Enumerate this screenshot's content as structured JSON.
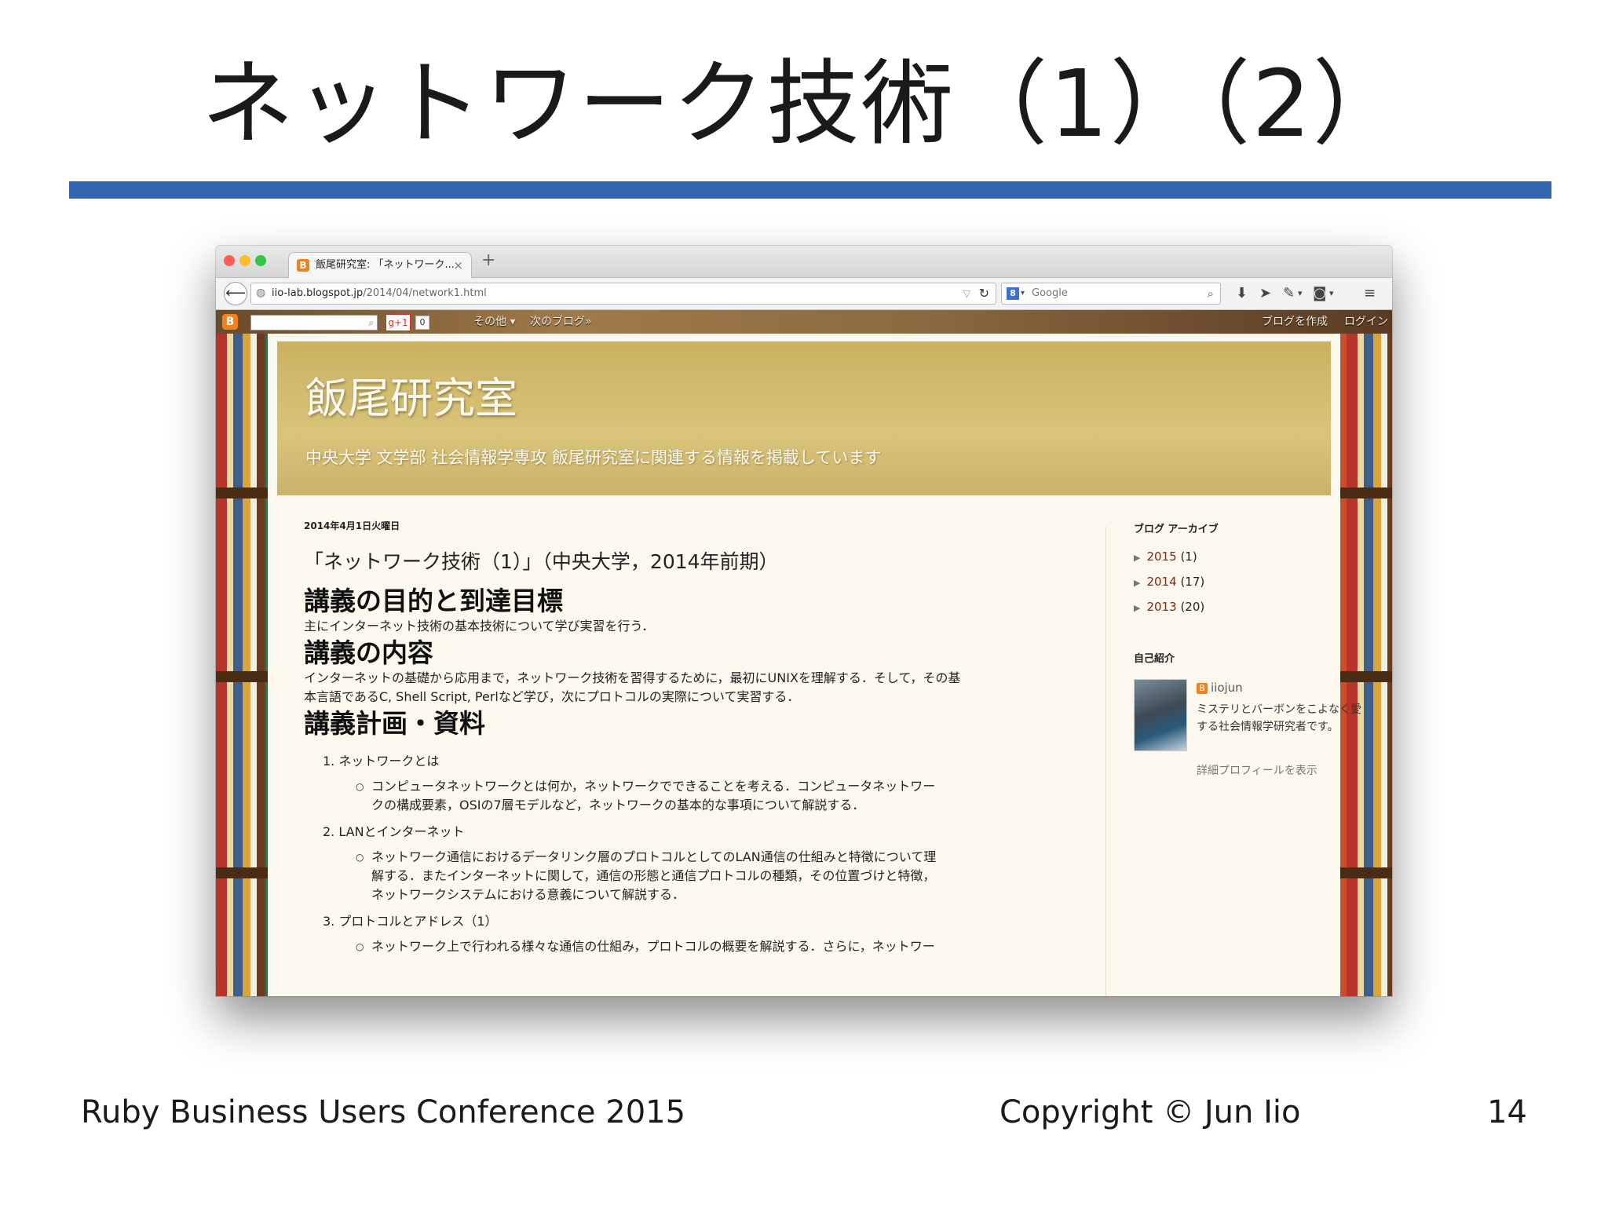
{
  "slide": {
    "title": "ネットワーク技術（1）（2）",
    "footer_left": "Ruby Business Users Conference 2015",
    "footer_center": "Copyright © Jun Iio",
    "page_number": "14"
  },
  "browser": {
    "tab_title": "飯尾研究室: 「ネットワーク...",
    "tab_close": "×",
    "new_tab": "+",
    "url_host": "iio-lab.blogspot.jp",
    "url_path": "/2014/04/network1.html",
    "search_placeholder": "Google"
  },
  "blogger_bar": {
    "plus_label": "g+1",
    "plus_count": "0",
    "more": "その他 ▾",
    "next_blog": "次のブログ»",
    "create_blog": "ブログを作成",
    "login": "ログイン"
  },
  "blog": {
    "title": "飯尾研究室",
    "description": "中央大学 文学部 社会情報学専攻 飯尾研究室に関連する情報を掲載しています"
  },
  "post": {
    "date": "2014年4月1日火曜日",
    "title": "「ネットワーク技術（1）」（中央大学，2014年前期）",
    "h_goal": "講義の目的と到達目標",
    "p_goal": "主にインターネット技術の基本技術について学び実習を行う．",
    "h_content": "講義の内容",
    "p_content_1": "インターネットの基礎から応用まで，ネットワーク技術を習得するために，最初にUNIXを理解する．そして，その基",
    "p_content_2": "本言語であるC, Shell Script, Perlなど学び，次にプロトコルの実際について実習する．",
    "h_plan": "講義計画・資料",
    "items": [
      {
        "label": "1. ネットワークとは",
        "lines": [
          "コンピュータネットワークとは何か，ネットワークでできることを考える．コンピュータネットワー",
          "クの構成要素，OSIの7層モデルなど，ネットワークの基本的な事項について解説する．"
        ]
      },
      {
        "label": "2. LANとインターネット",
        "lines": [
          "ネットワーク通信におけるデータリンク層のプロトコルとしてのLAN通信の仕組みと特徴について理",
          "解する．またインターネットに関して，通信の形態と通信プロトコルの種類，その位置づけと特徴，",
          "ネットワークシステムにおける意義について解説する．"
        ]
      },
      {
        "label": "3. プロトコルとアドレス（1）",
        "lines": [
          "ネットワーク上で行われる様々な通信の仕組み，プロトコルの概要を解説する．さらに，ネットワー"
        ]
      }
    ]
  },
  "sidebar": {
    "archive_heading": "ブログ アーカイブ",
    "archive": [
      {
        "year": "2015",
        "count": "(1)"
      },
      {
        "year": "2014",
        "count": "(17)"
      },
      {
        "year": "2013",
        "count": "(20)"
      }
    ],
    "profile_heading": "自己紹介",
    "profile_name": "iiojun",
    "profile_text": "ミステリとバーボンをこよなく愛する社会情報学研究者です。",
    "profile_link": "詳細プロフィールを表示"
  }
}
